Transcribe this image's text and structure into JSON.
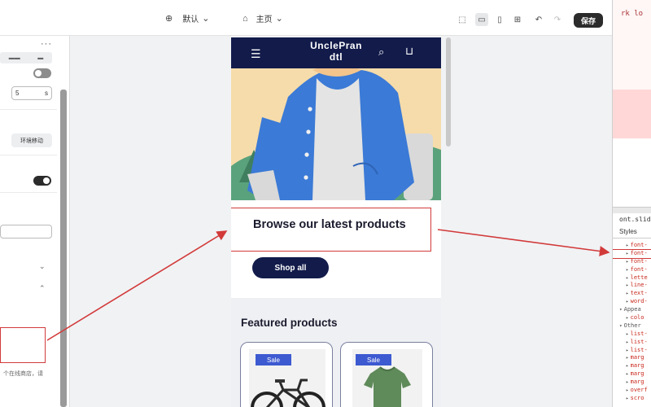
{
  "toolbar": {
    "theme_label": "默认",
    "page_label": "主页",
    "save_label": "保存"
  },
  "left_panel": {
    "input_value": "5",
    "input_unit": "s",
    "chip_label": "环境移动",
    "note_text": "个在线商店，请"
  },
  "store": {
    "name": "UnclePrandtl",
    "name_line1": "UnclePran",
    "name_line2": "dtl",
    "hero_title": "Browse our latest products",
    "shop_button": "Shop all",
    "featured_title": "Featured products",
    "products": [
      {
        "badge": "Sale",
        "image": "bicycle"
      },
      {
        "badge": "Sale",
        "image": "green-tshirt"
      }
    ]
  },
  "devtools": {
    "top_code": "rk lo",
    "breadcrumb": "ont.slid",
    "styles_tab": "Styles",
    "lines": [
      {
        "text": "font-",
        "kind": "prop"
      },
      {
        "text": "font-",
        "kind": "prop"
      },
      {
        "text": "font-",
        "kind": "prop"
      },
      {
        "text": "font-",
        "kind": "prop"
      },
      {
        "text": "lette",
        "kind": "prop"
      },
      {
        "text": "line-",
        "kind": "prop"
      },
      {
        "text": "text-",
        "kind": "prop"
      },
      {
        "text": "word-",
        "kind": "prop"
      },
      {
        "text": "Appea",
        "kind": "section"
      },
      {
        "text": "colo",
        "kind": "prop"
      },
      {
        "text": "Other",
        "kind": "section"
      },
      {
        "text": "list-",
        "kind": "prop"
      },
      {
        "text": "list-",
        "kind": "prop"
      },
      {
        "text": "list-",
        "kind": "prop"
      },
      {
        "text": "marg",
        "kind": "prop"
      },
      {
        "text": "marg",
        "kind": "prop"
      },
      {
        "text": "marg",
        "kind": "prop"
      },
      {
        "text": "marg",
        "kind": "prop"
      },
      {
        "text": "overf",
        "kind": "prop"
      },
      {
        "text": "scro",
        "kind": "prop"
      }
    ]
  },
  "colors": {
    "header_navy": "#121b4a",
    "annotation_red": "#d23a3a",
    "sale_blue": "#3d5ad1"
  }
}
